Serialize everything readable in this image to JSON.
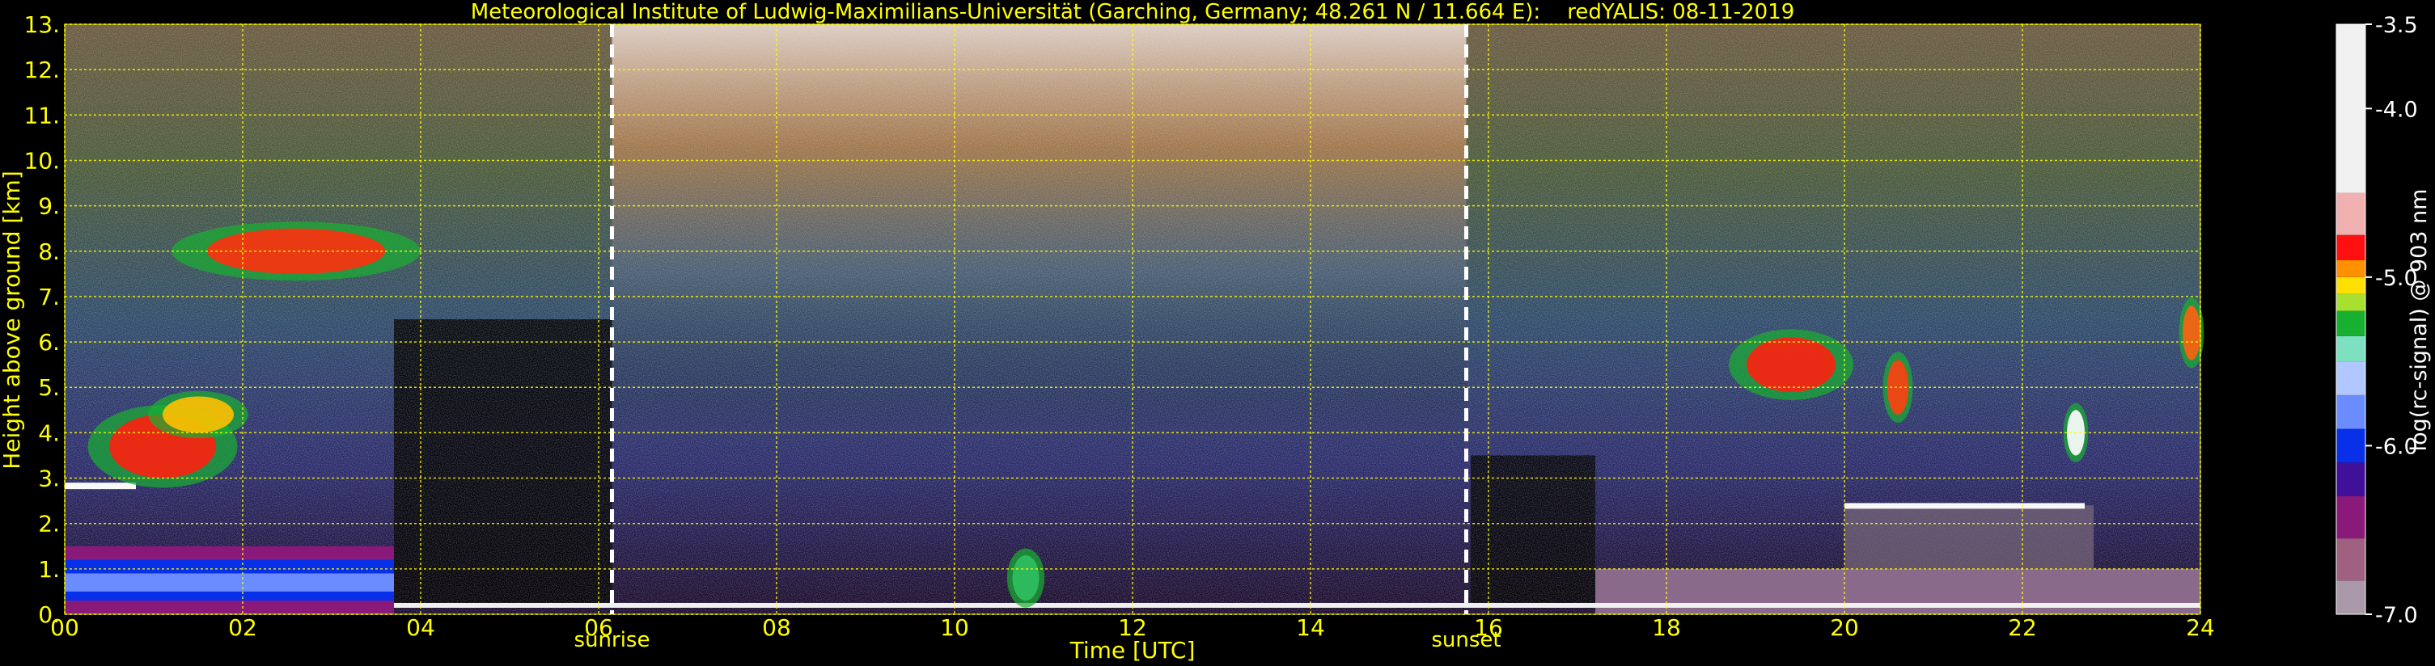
{
  "chart_data": {
    "type": "heatmap",
    "title": "Meteorological Institute of Ludwig-Maximilians-Universität (Garching, Germany; 48.261 N / 11.664 E):    redYALIS: 08-11-2019",
    "xlabel": "Time [UTC]",
    "ylabel": "Height above ground [km]",
    "xlim": [
      0,
      24
    ],
    "ylim": [
      0,
      13
    ],
    "x_ticks": [
      "00",
      "02",
      "04",
      "06",
      "08",
      "10",
      "12",
      "14",
      "16",
      "18",
      "20",
      "22",
      "24"
    ],
    "y_ticks": [
      "0.",
      "1.",
      "2.",
      "3.",
      "4.",
      "5.",
      "6.",
      "7.",
      "8.",
      "9.",
      "10.",
      "11.",
      "12.",
      "13."
    ],
    "grid": true,
    "markers": [
      {
        "label": "sunrise",
        "x": 6.15
      },
      {
        "label": "sunset",
        "x": 15.75
      }
    ],
    "colorbar": {
      "label": "log(rc-signal) @ 903 nm",
      "range": [
        -7.0,
        -3.5
      ],
      "ticks": [
        "-3.5",
        "-4.0",
        "-5.0",
        "-6.0",
        "-7.0"
      ],
      "tick_values": [
        -3.5,
        -4.0,
        -5.0,
        -6.0,
        -7.0
      ],
      "stops": [
        {
          "v": -7.0,
          "c": "#a898a8"
        },
        {
          "v": -6.8,
          "c": "#a0607f"
        },
        {
          "v": -6.55,
          "c": "#8a1a7a"
        },
        {
          "v": -6.3,
          "c": "#40109a"
        },
        {
          "v": -6.1,
          "c": "#0830e8"
        },
        {
          "v": -5.9,
          "c": "#6a8cff"
        },
        {
          "v": -5.7,
          "c": "#b0c8ff"
        },
        {
          "v": -5.5,
          "c": "#7de0c0"
        },
        {
          "v": -5.35,
          "c": "#18b030"
        },
        {
          "v": -5.2,
          "c": "#a8e030"
        },
        {
          "v": -5.1,
          "c": "#ffe000"
        },
        {
          "v": -5.0,
          "c": "#ff9000"
        },
        {
          "v": -4.9,
          "c": "#ff1010"
        },
        {
          "v": -4.75,
          "c": "#f0b0b0"
        },
        {
          "v": -4.5,
          "c": "#f0f0f0"
        },
        {
          "v": -3.5,
          "c": "#ffffff"
        }
      ]
    }
  }
}
